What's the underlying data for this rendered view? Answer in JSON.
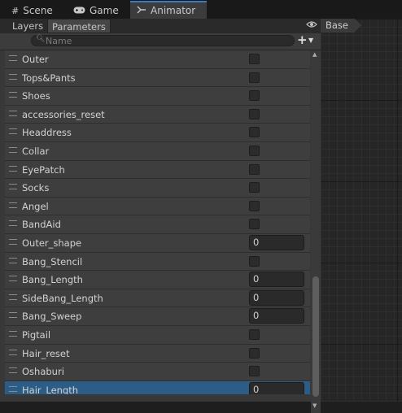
{
  "tabs": [
    {
      "label": "Scene",
      "icon": "grid-icon"
    },
    {
      "label": "Game",
      "icon": "gamepad-icon"
    },
    {
      "label": "Animator",
      "icon": "animator-icon"
    }
  ],
  "subtabs": {
    "layers": "Layers",
    "parameters": "Parameters"
  },
  "search": {
    "placeholder": "Name"
  },
  "breadcrumb": "Base",
  "colors": {
    "accent": "#3a79bb",
    "selected_row": "#2c5d87",
    "panel": "#383838"
  },
  "parameters": [
    {
      "name": "Outer",
      "type": "bool"
    },
    {
      "name": "Tops&Pants",
      "type": "bool"
    },
    {
      "name": "Shoes",
      "type": "bool"
    },
    {
      "name": "accessories_reset",
      "type": "bool"
    },
    {
      "name": "Headdress",
      "type": "bool"
    },
    {
      "name": "Collar",
      "type": "bool"
    },
    {
      "name": "EyePatch",
      "type": "bool"
    },
    {
      "name": "Socks",
      "type": "bool"
    },
    {
      "name": "Angel",
      "type": "bool"
    },
    {
      "name": "BandAid",
      "type": "bool"
    },
    {
      "name": "Outer_shape",
      "type": "float",
      "value": "0"
    },
    {
      "name": "Bang_Stencil",
      "type": "bool"
    },
    {
      "name": "Bang_Length",
      "type": "float",
      "value": "0"
    },
    {
      "name": "SideBang_Length",
      "type": "float",
      "value": "0"
    },
    {
      "name": "Bang_Sweep",
      "type": "float",
      "value": "0"
    },
    {
      "name": "Pigtail",
      "type": "bool"
    },
    {
      "name": "Hair_reset",
      "type": "bool"
    },
    {
      "name": "Oshaburi",
      "type": "bool"
    },
    {
      "name": "Hair_Length",
      "type": "float",
      "value": "0",
      "selected": true
    }
  ]
}
